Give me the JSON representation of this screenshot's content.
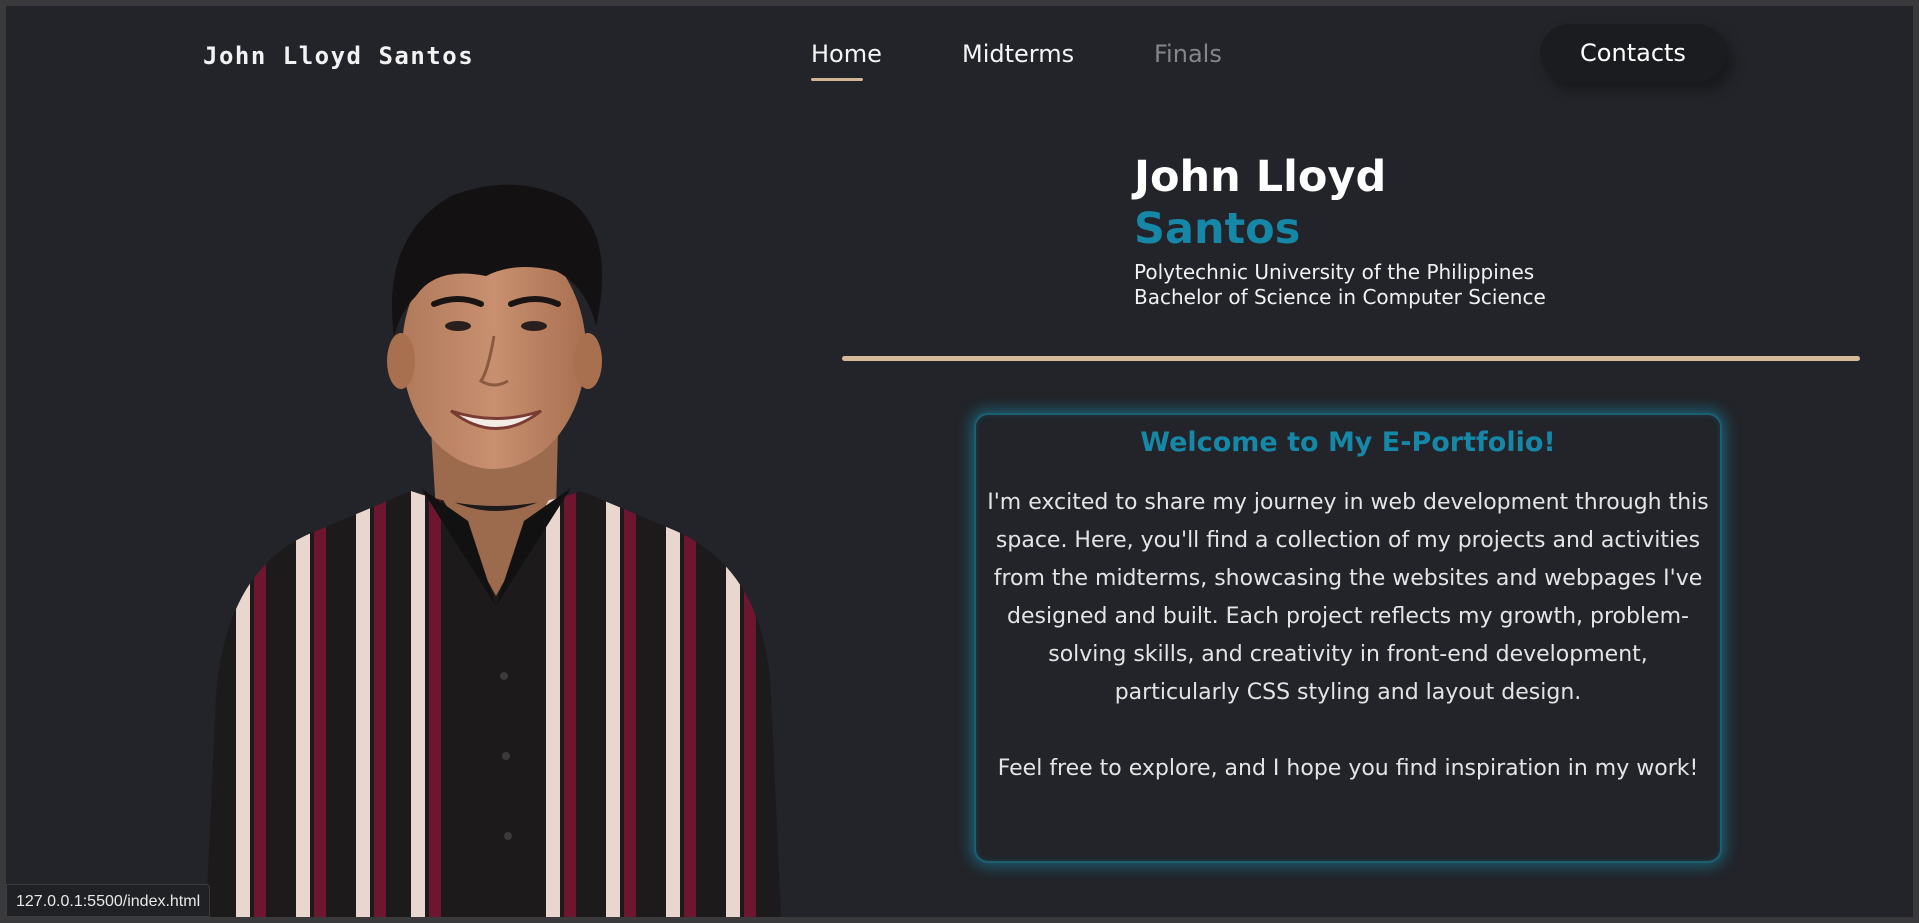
{
  "header": {
    "brand": "John Lloyd Santos",
    "nav": {
      "home": "Home",
      "midterms": "Midterms",
      "finals": "Finals"
    },
    "contacts": "Contacts"
  },
  "hero": {
    "first_name": "John Lloyd",
    "last_name": "Santos",
    "school": "Polytechnic University of the Philippines",
    "degree": "Bachelor of Science in Computer Science"
  },
  "welcome": {
    "title": "Welcome to My E-Portfolio!",
    "body": "I'm excited to share my journey in web development through this space. Here, you'll find a collection of my projects and activities from the midterms, showcasing the websites and webpages I've designed and built. Each project reflects my growth, problem-solving skills, and creativity in front-end development, particularly CSS styling and layout design.",
    "closing": "Feel free to explore, and I hope you find inspiration in my work!"
  },
  "status_bar": {
    "url": "127.0.0.1:5500/index.html"
  },
  "colors": {
    "background": "#222429",
    "accent_teal": "#1687a7",
    "accent_tan": "#d6b998",
    "text": "#f1f1f1",
    "muted_nav": "#85868a"
  }
}
